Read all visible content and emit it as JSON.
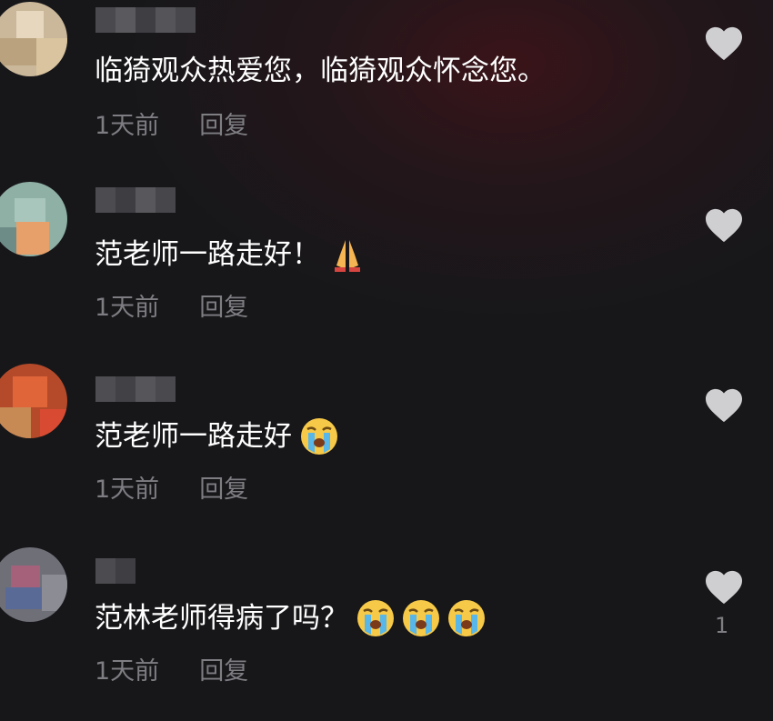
{
  "comments": [
    {
      "text": "临猗观众热爱您，临猗观众怀念您。",
      "emojis": [],
      "time": "1天前",
      "reply_label": "回复",
      "likes": ""
    },
    {
      "text": "范老师一路走好！",
      "emojis": [
        "folded-hands-emoji"
      ],
      "time": "1天前",
      "reply_label": "回复",
      "likes": ""
    },
    {
      "text": "范老师一路走好",
      "emojis": [
        "loudly-crying-face-emoji"
      ],
      "time": "1天前",
      "reply_label": "回复",
      "likes": ""
    },
    {
      "text": "范林老师得病了吗？",
      "emojis": [
        "loudly-crying-face-emoji",
        "loudly-crying-face-emoji",
        "loudly-crying-face-emoji"
      ],
      "time": "1天前",
      "reply_label": "回复",
      "likes": "1"
    }
  ],
  "colors": {
    "background": "#17171a",
    "text": "#ffffff",
    "secondary_text": "#7d7d82",
    "like_icon": "#cfcfd2"
  }
}
